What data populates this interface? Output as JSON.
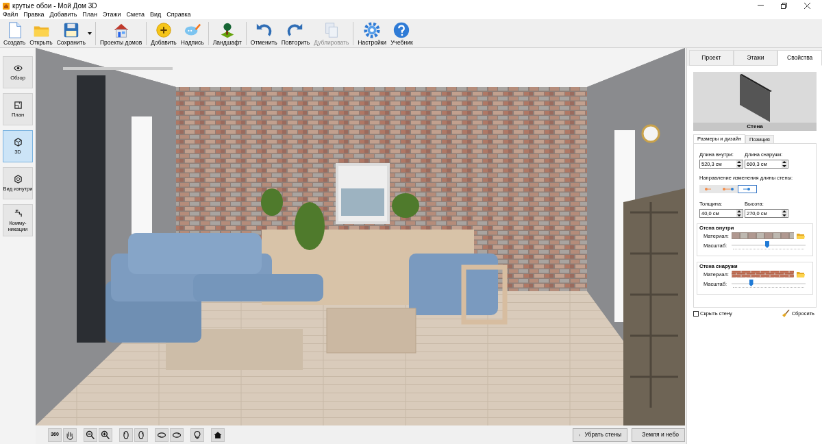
{
  "window": {
    "title": "крутые обои - Мой Дом 3D"
  },
  "menu": [
    "Файл",
    "Правка",
    "Добавить",
    "План",
    "Этажи",
    "Смета",
    "Вид",
    "Справка"
  ],
  "toolbar": {
    "groups": [
      [
        {
          "label": "Создать",
          "disabled": false
        },
        {
          "label": "Открыть",
          "disabled": false
        },
        {
          "label": "Сохранить",
          "disabled": false,
          "dropdown": true
        }
      ],
      [
        {
          "label": "Проекты домов",
          "disabled": false
        }
      ],
      [
        {
          "label": "Добавить",
          "disabled": false
        },
        {
          "label": "Надпись",
          "disabled": false
        }
      ],
      [
        {
          "label": "Ландшафт",
          "disabled": false
        }
      ],
      [
        {
          "label": "Отменить",
          "disabled": false
        },
        {
          "label": "Повторить",
          "disabled": false
        },
        {
          "label": "Дублировать",
          "disabled": true
        }
      ],
      [
        {
          "label": "Настройки",
          "disabled": false
        },
        {
          "label": "Учебник",
          "disabled": false
        }
      ]
    ]
  },
  "sidebar": {
    "items": [
      {
        "label": "Обзор",
        "selected": false
      },
      {
        "label": "План",
        "selected": false
      },
      {
        "label": "3D",
        "selected": true
      },
      {
        "label": "Вид изнутри",
        "selected": false
      },
      {
        "label": "Комму-\nникации",
        "selected": false
      }
    ]
  },
  "view_tools_label": "360",
  "view_buttons": [
    "Убрать стены",
    "Земля и небо"
  ],
  "panel": {
    "tabs": [
      {
        "label": "Проект",
        "selected": false
      },
      {
        "label": "Этажи",
        "selected": false
      },
      {
        "label": "Свойства",
        "selected": true
      }
    ],
    "preview_caption": "Стена",
    "subtabs": [
      {
        "label": "Размеры и дизайн",
        "selected": true
      },
      {
        "label": "Позиция",
        "selected": false
      }
    ],
    "length_inside": {
      "label": "Длина внутри:",
      "value": "520,3 см"
    },
    "length_outside": {
      "label": "Длина снаружи:",
      "value": "600,3 см"
    },
    "direction_label": "Направление изменения длины стены:",
    "directions": [
      {
        "selected": false
      },
      {
        "selected": false
      },
      {
        "selected": true
      }
    ],
    "thickness": {
      "label": "Толщина:",
      "value": "40,0 см"
    },
    "height": {
      "label": "Высота:",
      "value": "270,0 см"
    },
    "wall_inside": {
      "title": "Стена внутри",
      "material_label": "Материал:",
      "scale_label": "Масштаб:",
      "level": 0.48
    },
    "wall_outside": {
      "title": "Стена снаружи",
      "material_label": "Материал:",
      "scale_label": "Масштаб:",
      "level": 0.25
    },
    "hide_wall": {
      "label": "Скрыть стену",
      "checked": false
    },
    "reset_button": "Сбросить"
  }
}
